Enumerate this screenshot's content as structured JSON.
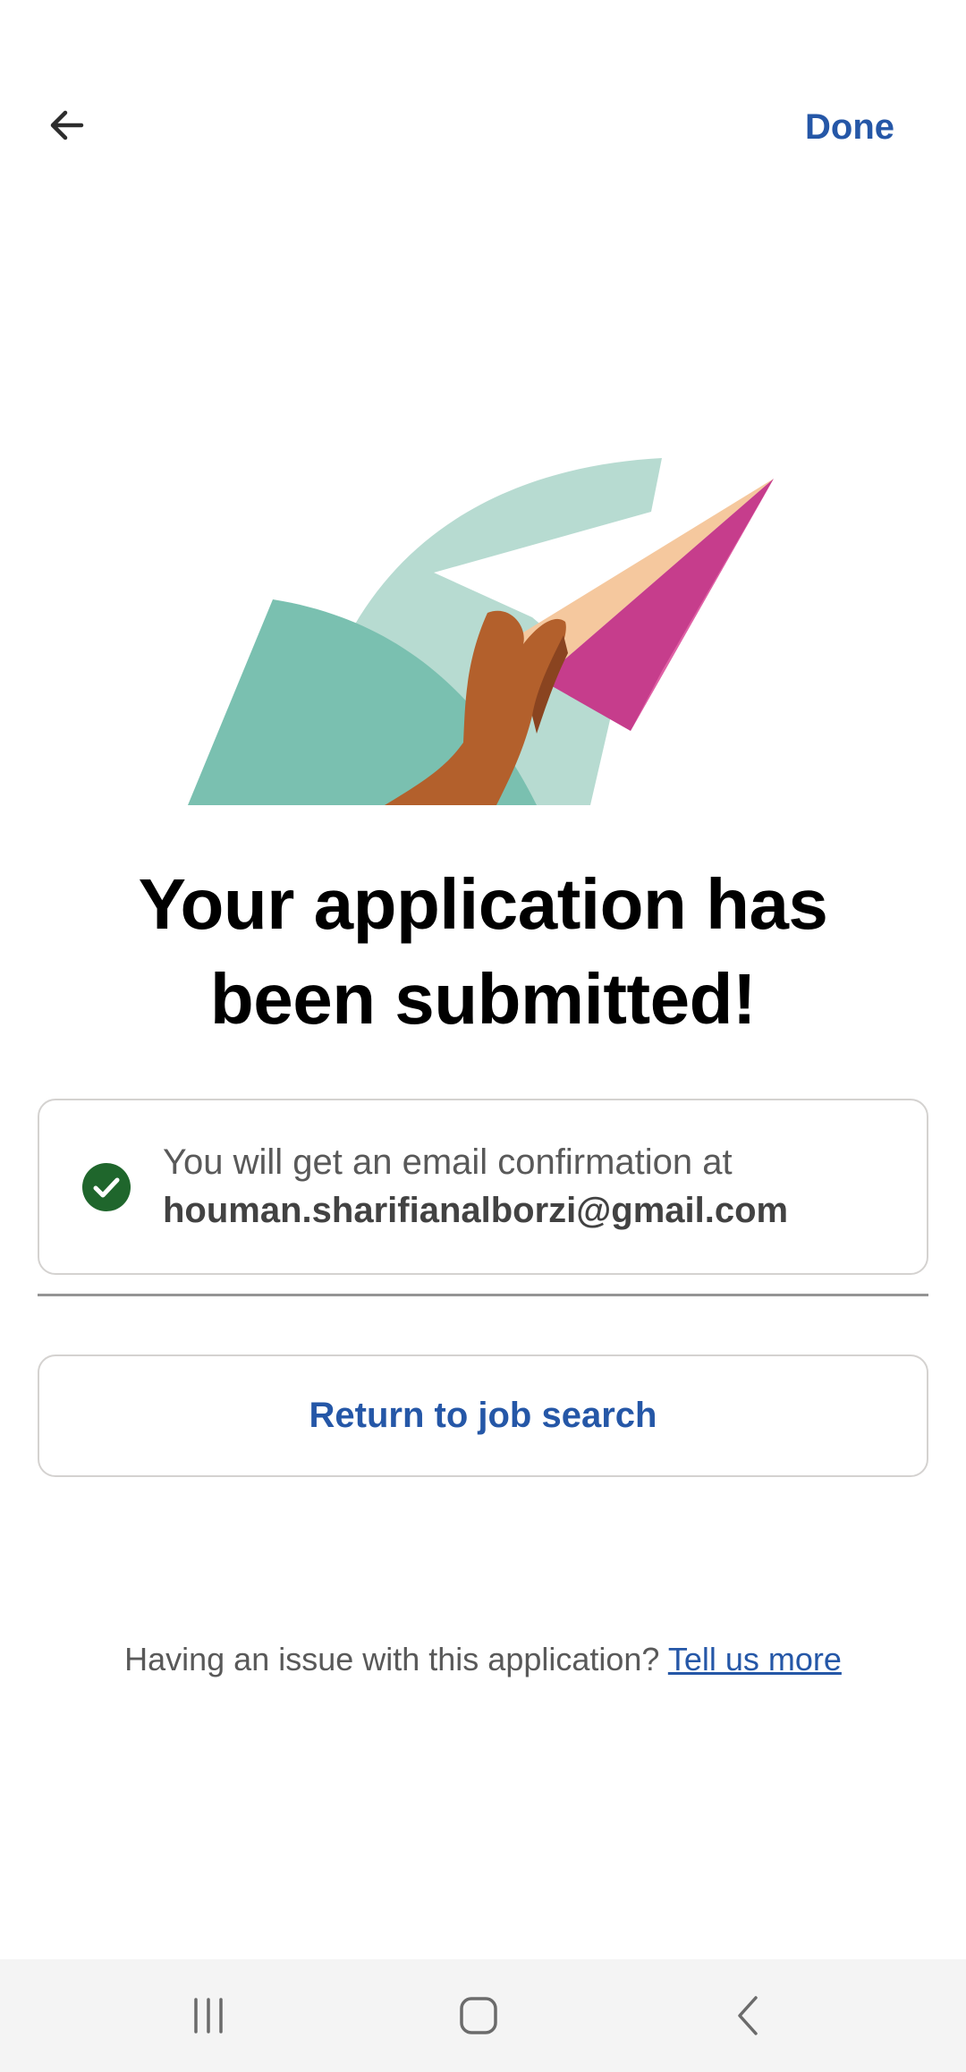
{
  "topbar": {
    "back_icon": "arrow-left-icon",
    "done_label": "Done"
  },
  "illustration": {
    "name": "hand-throwing-paper-plane"
  },
  "heading": {
    "line1": "Your application has",
    "line2": "been submitted!"
  },
  "confirmation": {
    "icon": "check-circle-icon",
    "text": "You will get an email confirmation at",
    "email": "houman.sharifianalborzi@gmail.com"
  },
  "actions": {
    "return_label": "Return to job search"
  },
  "footer": {
    "question": "Having an issue with this application? ",
    "link_label": "Tell us more"
  },
  "navbar": {
    "recents_icon": "recents-icon",
    "home_icon": "home-icon",
    "back_icon": "back-chevron-icon"
  },
  "colors": {
    "brand_blue": "#2557a7",
    "success_green": "#1f662c",
    "text_gray": "#595959"
  }
}
